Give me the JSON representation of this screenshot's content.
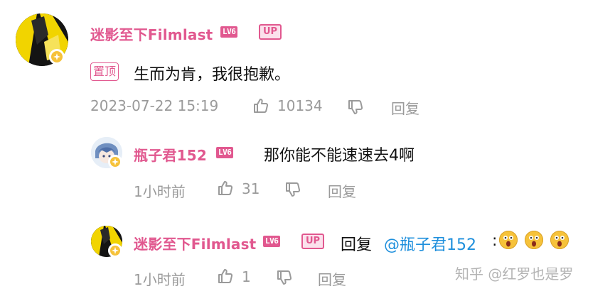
{
  "main_comment": {
    "username": "迷影至下Filmlast",
    "level": "LV6",
    "up_badge": "UP",
    "pinned_label": "置顶",
    "text": "生而为肯，我很抱歉。",
    "timestamp": "2023-07-22 15:19",
    "like_count": "10134",
    "reply_label": "回复"
  },
  "replies": [
    {
      "username": "瓶子君152",
      "level": "LV6",
      "text": "那你能不能速速去4啊",
      "timestamp": "1小时前",
      "like_count": "31",
      "reply_label": "回复"
    },
    {
      "username": "迷影至下Filmlast",
      "level": "LV6",
      "up_badge": "UP",
      "reply_prefix": "回复",
      "mention": "@瓶子君152",
      "separator": ":",
      "timestamp": "1小时前",
      "like_count": "1",
      "reply_label": "回复"
    }
  ],
  "watermark": "知乎 @红罗也是罗",
  "colors": {
    "username": "#e1588f",
    "meta": "#9a9a9a",
    "mention": "#1e8fdc",
    "badge": "#f6c23a"
  }
}
